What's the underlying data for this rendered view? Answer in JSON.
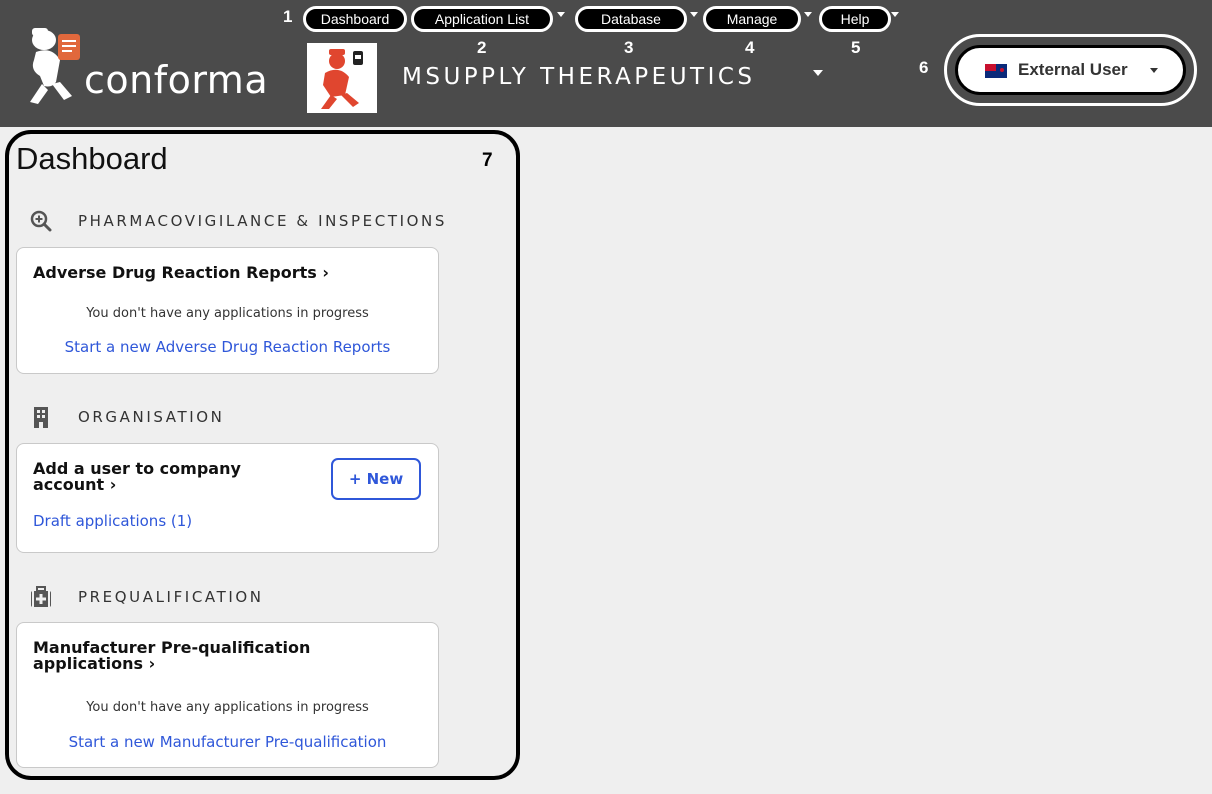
{
  "app": {
    "logo_text": "conforma",
    "organisation": "MSUPPLY THERAPEUTICS"
  },
  "nav": {
    "items": [
      {
        "label": "Dashboard",
        "callout": "1"
      },
      {
        "label": "Application List",
        "callout": "2"
      },
      {
        "label": "Database",
        "callout": "3"
      },
      {
        "label": "Manage",
        "callout": "4"
      },
      {
        "label": "Help",
        "callout": "5"
      }
    ]
  },
  "user": {
    "label": "External User",
    "callout": "6"
  },
  "dashboard": {
    "title": "Dashboard",
    "callout": "7",
    "sections": [
      {
        "label": "PHARMACOVIGILANCE & INSPECTIONS",
        "icon": "magnify-plus-icon",
        "card": {
          "title": "Adverse Drug Reaction Reports",
          "note": "You don't have any applications in progress",
          "link": "Start a new Adverse Drug Reaction Reports"
        }
      },
      {
        "label": "ORGANISATION",
        "icon": "building-icon",
        "card": {
          "title_line1": "Add a user to company",
          "title_line2": "account",
          "button": "+ New",
          "link": "Draft applications (1)"
        }
      },
      {
        "label": "PREQUALIFICATION",
        "icon": "medical-kit-icon",
        "card": {
          "title_line1": "Manufacturer Pre-qualification",
          "title_line2": "applications",
          "note": "You don't have any applications in progress",
          "link": "Start a new Manufacturer Pre-qualification"
        }
      }
    ]
  },
  "colors": {
    "header_bg": "#4b4b4b",
    "page_bg": "#efefef",
    "link": "#2f57d9"
  }
}
